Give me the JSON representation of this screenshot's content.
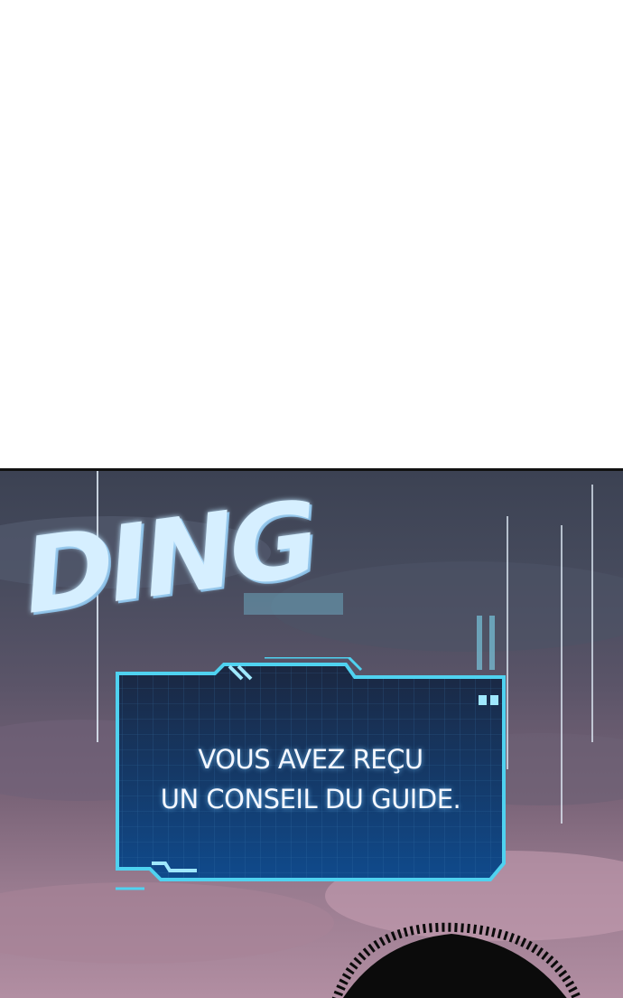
{
  "sound_effect": "DING",
  "system_message": {
    "line1": "VOUS AVEZ REÇU",
    "line2": "UN CONSEIL DU GUIDE."
  },
  "colors": {
    "window_border": "#4fd2f0",
    "window_fill": "#123a6e",
    "sky_top": "#3c4253",
    "sky_bottom": "#b28ea2"
  }
}
